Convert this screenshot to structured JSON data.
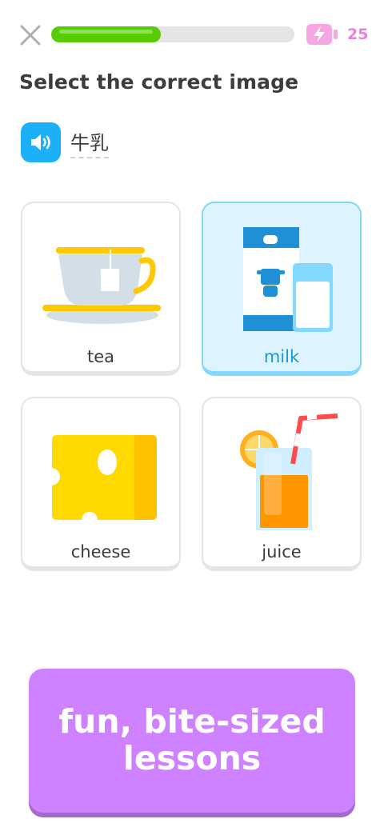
{
  "header": {
    "progress_fraction": 0.45,
    "energy_count": "25",
    "icons": {
      "close": "close-icon",
      "energy": "energy-battery-icon"
    }
  },
  "prompt": {
    "title": "Select the correct image"
  },
  "audio": {
    "icon": "speaker-icon",
    "word": "牛乳"
  },
  "choices": [
    {
      "label": "tea",
      "icon": "teacup-icon",
      "selected": false
    },
    {
      "label": "milk",
      "icon": "milk-carton-icon",
      "selected": true
    },
    {
      "label": "cheese",
      "icon": "cheese-icon",
      "selected": false
    },
    {
      "label": "juice",
      "icon": "juice-glass-icon",
      "selected": false
    }
  ],
  "promo": {
    "text": "fun, bite-sized lessons"
  },
  "colors": {
    "progress": "#58cc02",
    "energy": "#e882d6",
    "audio": "#1cb0f6",
    "selected_bg": "#ddf4ff",
    "selected_border": "#84d8ff",
    "promo": "#ce82ff"
  }
}
